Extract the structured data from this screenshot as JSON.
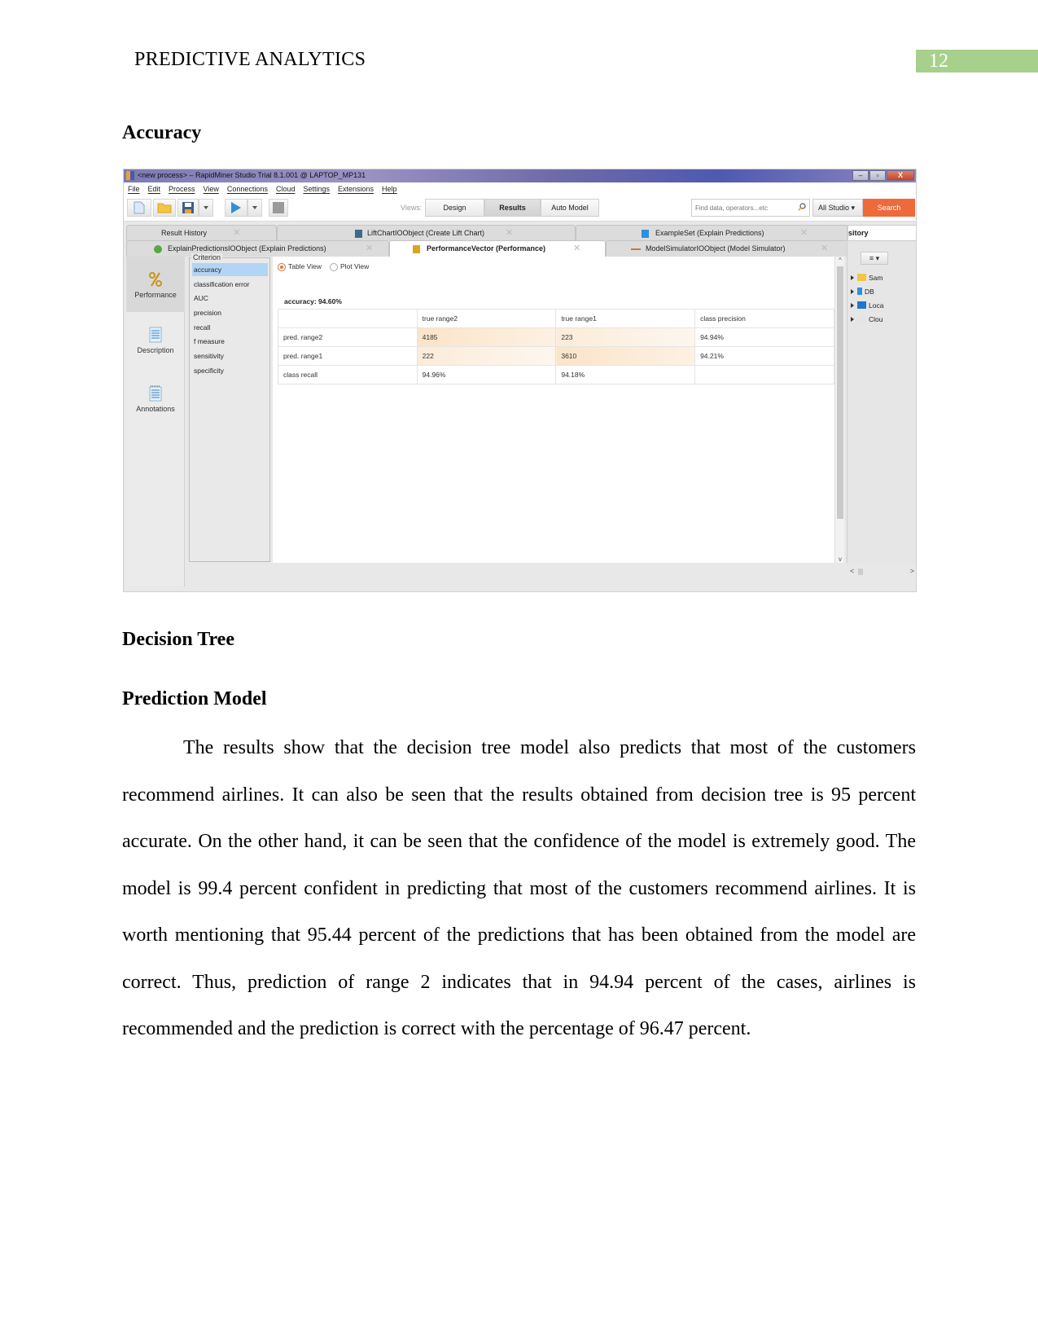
{
  "header": {
    "running_head": "PREDICTIVE ANALYTICS",
    "page_number": "12",
    "page_number_bg": "#a8d08d"
  },
  "sections": {
    "accuracy_heading": "Accuracy",
    "decision_tree_heading": "Decision Tree",
    "prediction_model_heading": "Prediction Model"
  },
  "screenshot": {
    "window_title": "<new process> – RapidMiner Studio Trial 8.1.001 @ LAPTOP_MP131",
    "window_buttons": [
      "–",
      "▫",
      "X"
    ],
    "menu": [
      "File",
      "Edit",
      "Process",
      "View",
      "Connections",
      "Cloud",
      "Settings",
      "Extensions",
      "Help"
    ],
    "toolbar": {
      "icons": [
        "new-process-icon",
        "open-folder-icon",
        "save-icon",
        "dropdown-icon",
        "run-icon",
        "dropdown-icon",
        "stop-icon"
      ],
      "views_label": "Views:",
      "views": [
        {
          "label": "Design",
          "active": false
        },
        {
          "label": "Results",
          "active": true
        },
        {
          "label": "Auto Model",
          "active": false
        }
      ],
      "search_placeholder": "Find data, operators...etc",
      "scope": "All Studio ▾",
      "search_button": "Search",
      "accent_color": "#ee6a3b"
    },
    "tabs_row1": [
      {
        "label": "Result History",
        "icon": ""
      },
      {
        "label": "LiftChartIOObject (Create Lift Chart)",
        "icon": "lift-chart-icon"
      },
      {
        "label": "ExampleSet (Explain Predictions)",
        "icon": "example-set-icon"
      }
    ],
    "tabs_row2": [
      {
        "label": "ExplainPredictionsIOObject (Explain Predictions)",
        "icon": "explain-predictions-icon",
        "active": false
      },
      {
        "label": "PerformanceVector (Performance)",
        "icon": "performance-icon",
        "active": true
      },
      {
        "label": "ModelSimulatorIOObject (Model Simulator)",
        "icon": "model-simulator-icon",
        "active": false
      }
    ],
    "sidebar": [
      {
        "label": "Performance",
        "icon": "percent-icon",
        "active": true
      },
      {
        "label": "Description",
        "icon": "document-icon",
        "active": false
      },
      {
        "label": "Annotations",
        "icon": "notepad-icon",
        "active": false
      }
    ],
    "criterion": {
      "title": "Criterion",
      "items": [
        "accuracy",
        "classification error",
        "AUC",
        "precision",
        "recall",
        "f measure",
        "sensitivity",
        "specificity"
      ],
      "selected": "accuracy"
    },
    "view_toggle": {
      "table_view": "Table View",
      "plot_view": "Plot View",
      "selected": "Table View"
    },
    "accuracy_label": "accuracy: 94.60%",
    "table": {
      "columns": [
        "",
        "true range2",
        "true range1",
        "class precision"
      ],
      "rows": [
        [
          "pred. range2",
          "4185",
          "223",
          "94.94%"
        ],
        [
          "pred. range1",
          "222",
          "3610",
          "94.21%"
        ],
        [
          "class recall",
          "94.96%",
          "94.18%",
          ""
        ]
      ]
    },
    "repository": {
      "tab_label": "sitory",
      "menu_button": "≡ ▾",
      "items": [
        "Sam",
        "DB",
        "Loca",
        "Clou"
      ]
    }
  },
  "body": {
    "paragraph": "The results show that the decision tree model also predicts that most of the customers recommend airlines. It can also be seen that the results obtained from decision tree is 95 percent accurate. On the other hand, it can be seen that the confidence of the model is extremely good. The model is 99.4 percent confident in predicting that most of the customers recommend airlines. It is worth mentioning that 95.44 percent of the predictions that has been obtained from the model are correct. Thus, prediction of range 2 indicates that in 94.94 percent of the cases, airlines is recommended and the prediction is correct with the percentage of 96.47 percent."
  }
}
